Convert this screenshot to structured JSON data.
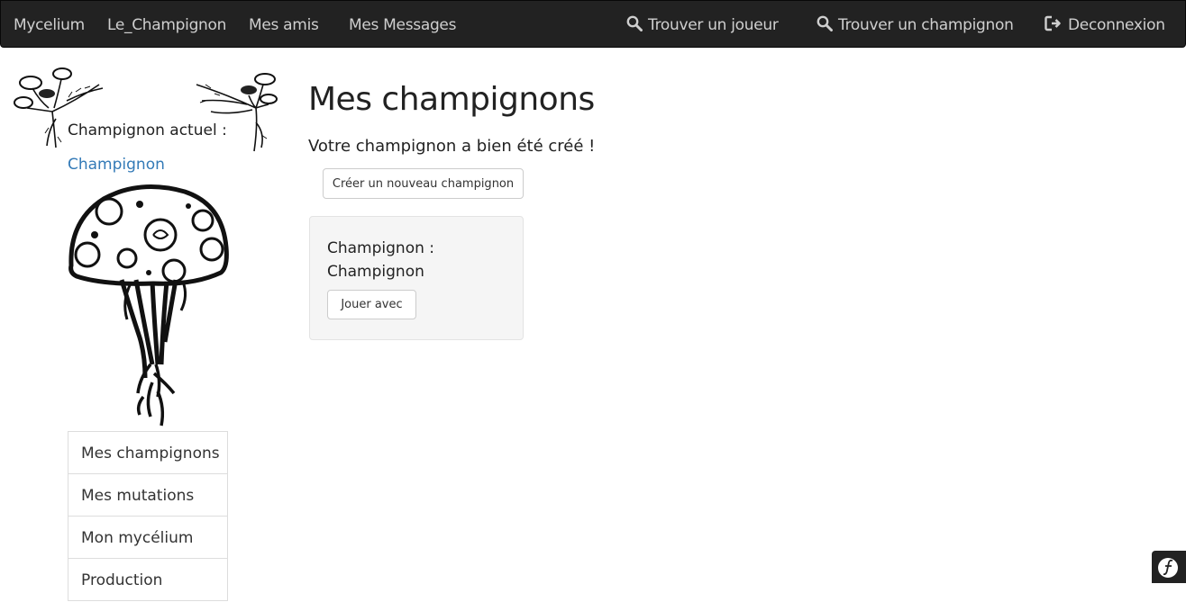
{
  "navbar": {
    "left": [
      "Mycelium",
      "Le_Champignon",
      "Mes amis",
      "Mes Messages"
    ],
    "find_player": "Trouver un joueur",
    "find_mushroom": "Trouver un champignon",
    "logout": "Deconnexion"
  },
  "sidebar": {
    "current_label": "Champignon actuel :",
    "current_link": "Champignon",
    "menu": [
      "Mes champignons",
      "Mes mutations",
      "Mon mycélium",
      "Production"
    ]
  },
  "main": {
    "title": "Mes champignons",
    "flash": "Votre champignon a bien été créé !",
    "create_button": "Créer un nouveau champignon",
    "card": {
      "line1": "Champignon :",
      "line2": "Champignon",
      "play_button": "Jouer avec"
    }
  }
}
